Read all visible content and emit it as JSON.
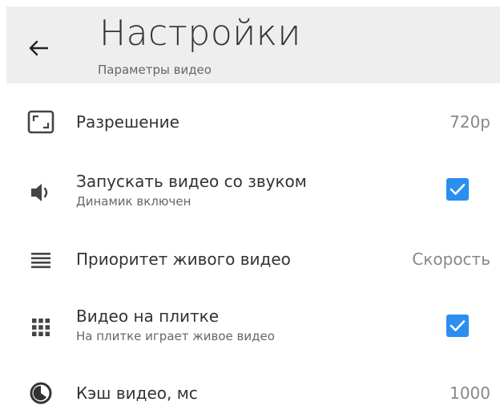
{
  "header": {
    "title": "Настройки",
    "subtitle": "Параметры видео",
    "back_icon": "arrow-left-icon",
    "background": "#eeeeee"
  },
  "settings": [
    {
      "icon": "aspect-ratio-icon",
      "label": "Разрешение",
      "value": "720p"
    },
    {
      "icon": "speaker-icon",
      "label": "Запускать видео со звуком",
      "sublabel": "Динамик включен",
      "checked": true
    },
    {
      "icon": "list-icon",
      "label": "Приоритет живого видео",
      "value": "Скорость"
    },
    {
      "icon": "grid-icon",
      "label": "Видео на плитке",
      "sublabel": "На плитке играет живое видео",
      "checked": true
    },
    {
      "icon": "timer-icon",
      "label": "Кэш видео, мс",
      "value": "1000"
    }
  ],
  "colors": {
    "accent": "#2b8ff0",
    "text": "#333333",
    "secondary": "#666666",
    "value": "#888888"
  }
}
